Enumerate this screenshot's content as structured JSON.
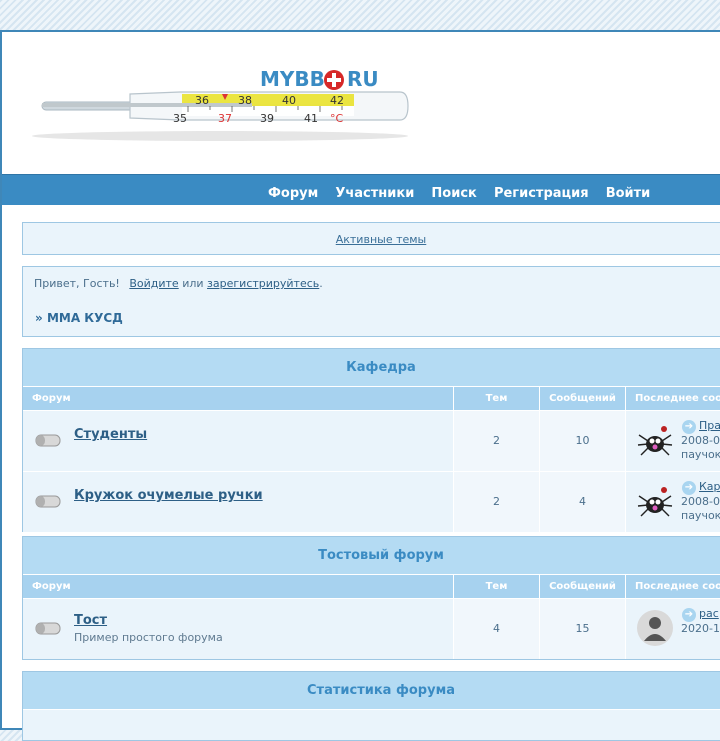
{
  "logo": {
    "brand_text": "MYBB",
    "brand_suffix": "RU"
  },
  "nav": {
    "items": [
      "Форум",
      "Участники",
      "Поиск",
      "Регистрация",
      "Войти"
    ]
  },
  "active_topics": {
    "label": "Активные темы"
  },
  "welcome": {
    "greeting": "Привет, Гость!",
    "login_link": "Войдите",
    "or_text": "или",
    "register_link": "зарегистрируйтесь",
    "period": ".",
    "crumb_prefix": "»",
    "crumb": "MMA КУСД"
  },
  "columns": {
    "forum": "Форум",
    "topics": "Тем",
    "posts": "Сообщений",
    "last_post": "Последнее сообщение"
  },
  "categories": [
    {
      "title": "Кафедра",
      "forums": [
        {
          "name": "Студенты",
          "description": "",
          "topics": "2",
          "posts": "10",
          "last_link": "Пра",
          "last_date": "2008-0",
          "last_user": "паучок"
        },
        {
          "name": "Кружок очумелые ручки",
          "description": "",
          "topics": "2",
          "posts": "4",
          "last_link": "Кар",
          "last_date": "2008-0",
          "last_user": "паучок"
        }
      ]
    },
    {
      "title": "Тостовый форум",
      "forums": [
        {
          "name": "Тост",
          "description": "Пример простого форума",
          "topics": "4",
          "posts": "15",
          "last_link": "рас",
          "last_date": "2020-1",
          "last_user": ""
        }
      ]
    }
  ],
  "stats": {
    "title": "Статистика форума"
  },
  "colors": {
    "accent": "#3a8bc3",
    "category_header": "#b4dbf3",
    "column_header": "#a7d2ef",
    "link": "#2d5f86"
  },
  "icons": {
    "forum_icon": "forum-pill-icon",
    "last_arrow": "arrow-right-icon",
    "avatar_spider": "spider-avatar",
    "avatar_default": "default-user-avatar"
  }
}
